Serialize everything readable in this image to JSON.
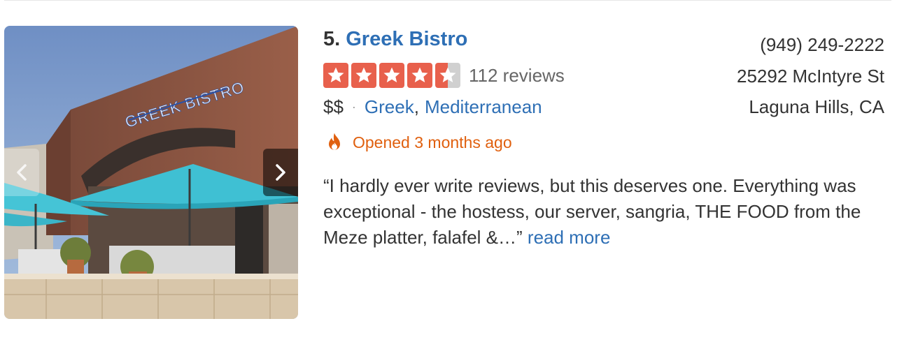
{
  "listing": {
    "rank": "5.",
    "name": "Greek Bistro",
    "rating": 4.5,
    "rating_max": 5,
    "review_count": "112 reviews",
    "price": "$$",
    "separator": "·",
    "categories": [
      "Greek",
      "Mediterranean"
    ],
    "category_separator": ",",
    "opened_text": "Opened 3 months ago",
    "snippet": "“I hardly ever write reviews, but this deserves one. Everything was exceptional - the hostess, our server, sangria, THE FOOD from the Meze platter, falafel &…”",
    "read_more": "read more",
    "phone": "(949) 249-2222",
    "address_line1": "25292 McIntyre St",
    "address_line2": "Laguna Hills, CA"
  },
  "photo": {
    "sign_text": "GREEK BISTRO",
    "prev_icon": "chevron-left-icon",
    "next_icon": "chevron-right-icon"
  },
  "colors": {
    "link": "#2e6fb5",
    "star_fill": "#e8604c",
    "star_empty": "#d0d0d0",
    "opened": "#e0600f",
    "text": "#333333",
    "muted": "#666666"
  }
}
